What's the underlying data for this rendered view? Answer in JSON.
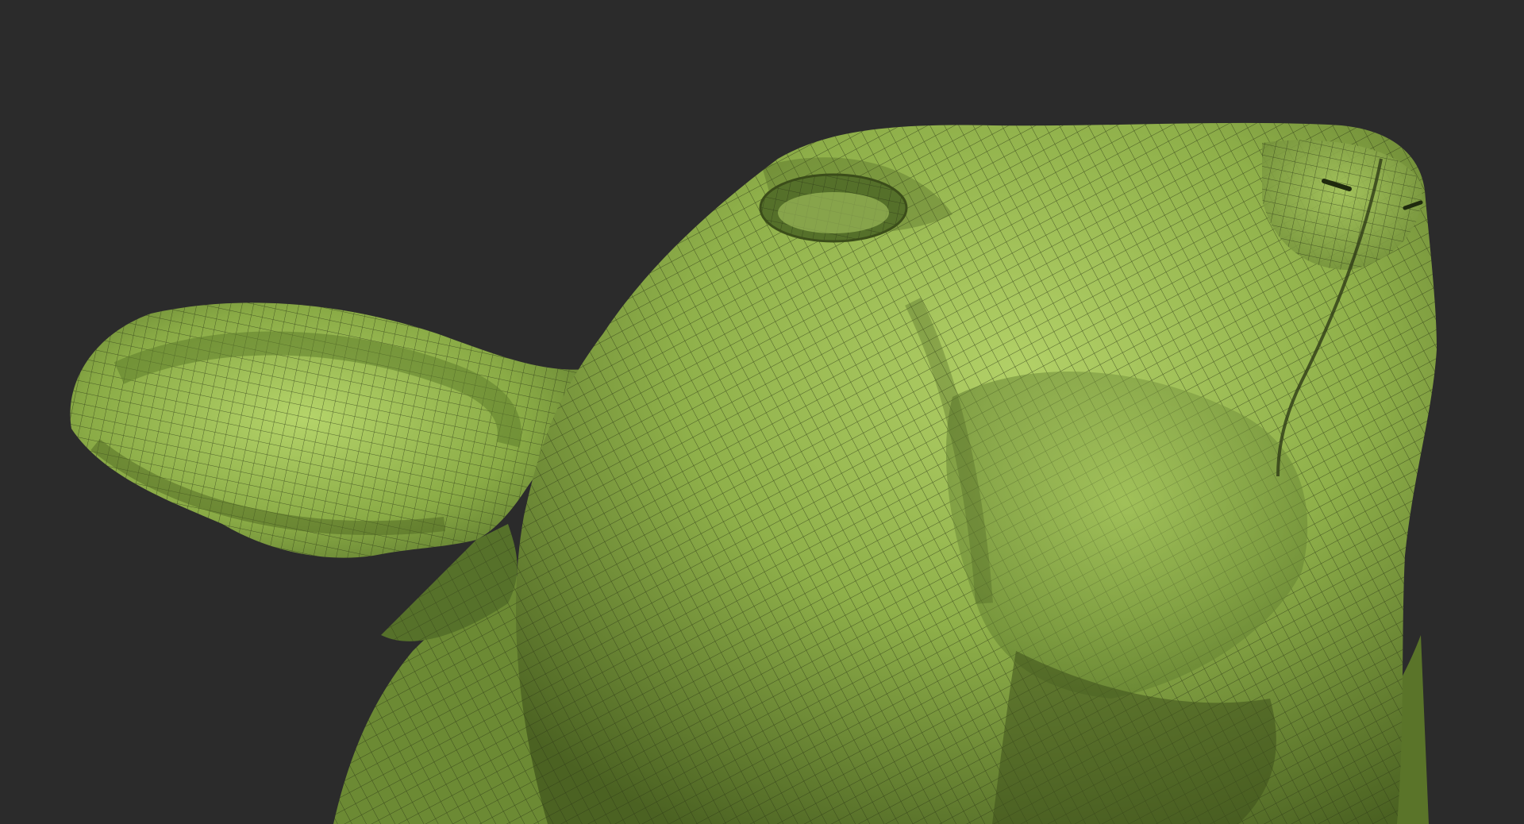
{
  "scene": {
    "subject": "",
    "background_color": "#2b2b2b",
    "mesh_base_color": "#8fb04a",
    "mesh_highlight_color": "#b2d067",
    "mesh_shadow_color": "#4b6222",
    "wire_color": "#2e3b17"
  }
}
